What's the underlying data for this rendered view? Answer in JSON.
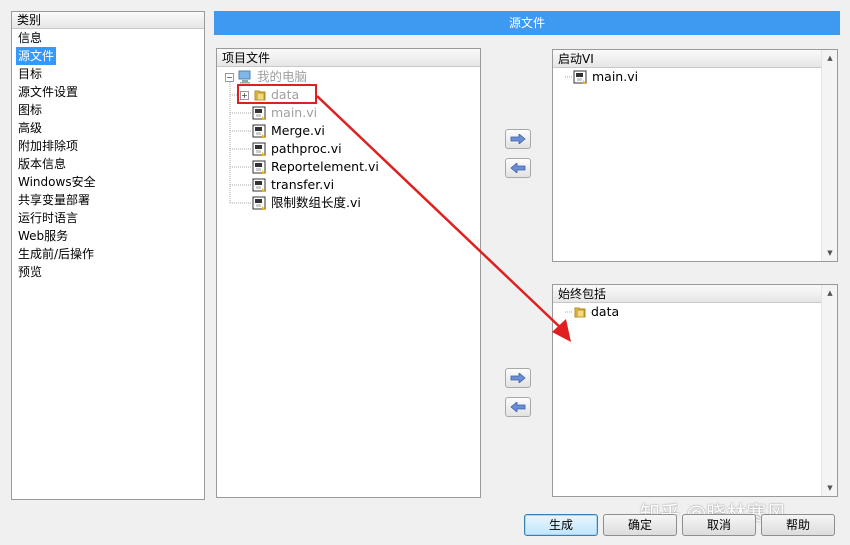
{
  "categories": {
    "header": "类别",
    "items": [
      "信息",
      "源文件",
      "目标",
      "源文件设置",
      "图标",
      "高级",
      "附加排除项",
      "版本信息",
      "Windows安全",
      "共享变量部署",
      "运行时语言",
      "Web服务",
      "生成前/后操作",
      "预览"
    ],
    "selected_index": 1
  },
  "title": "源文件",
  "project_files": {
    "header": "项目文件",
    "root_label": "我的电脑",
    "items": [
      "data",
      "main.vi",
      "Merge.vi",
      "pathproc.vi",
      "Reportelement.vi",
      "transfer.vi",
      "限制数组长度.vi"
    ]
  },
  "startup_vi": {
    "header": "启动VI",
    "items": [
      "main.vi"
    ]
  },
  "always_included": {
    "header": "始终包括",
    "items": [
      "data"
    ]
  },
  "buttons": {
    "build": "生成",
    "ok": "确定",
    "cancel": "取消",
    "help": "帮助"
  },
  "watermark": "知乎 @晓林寒风",
  "colors": {
    "title_bar": "#3d9af0",
    "selection": "#3399ff",
    "annotation": "#e02020"
  }
}
